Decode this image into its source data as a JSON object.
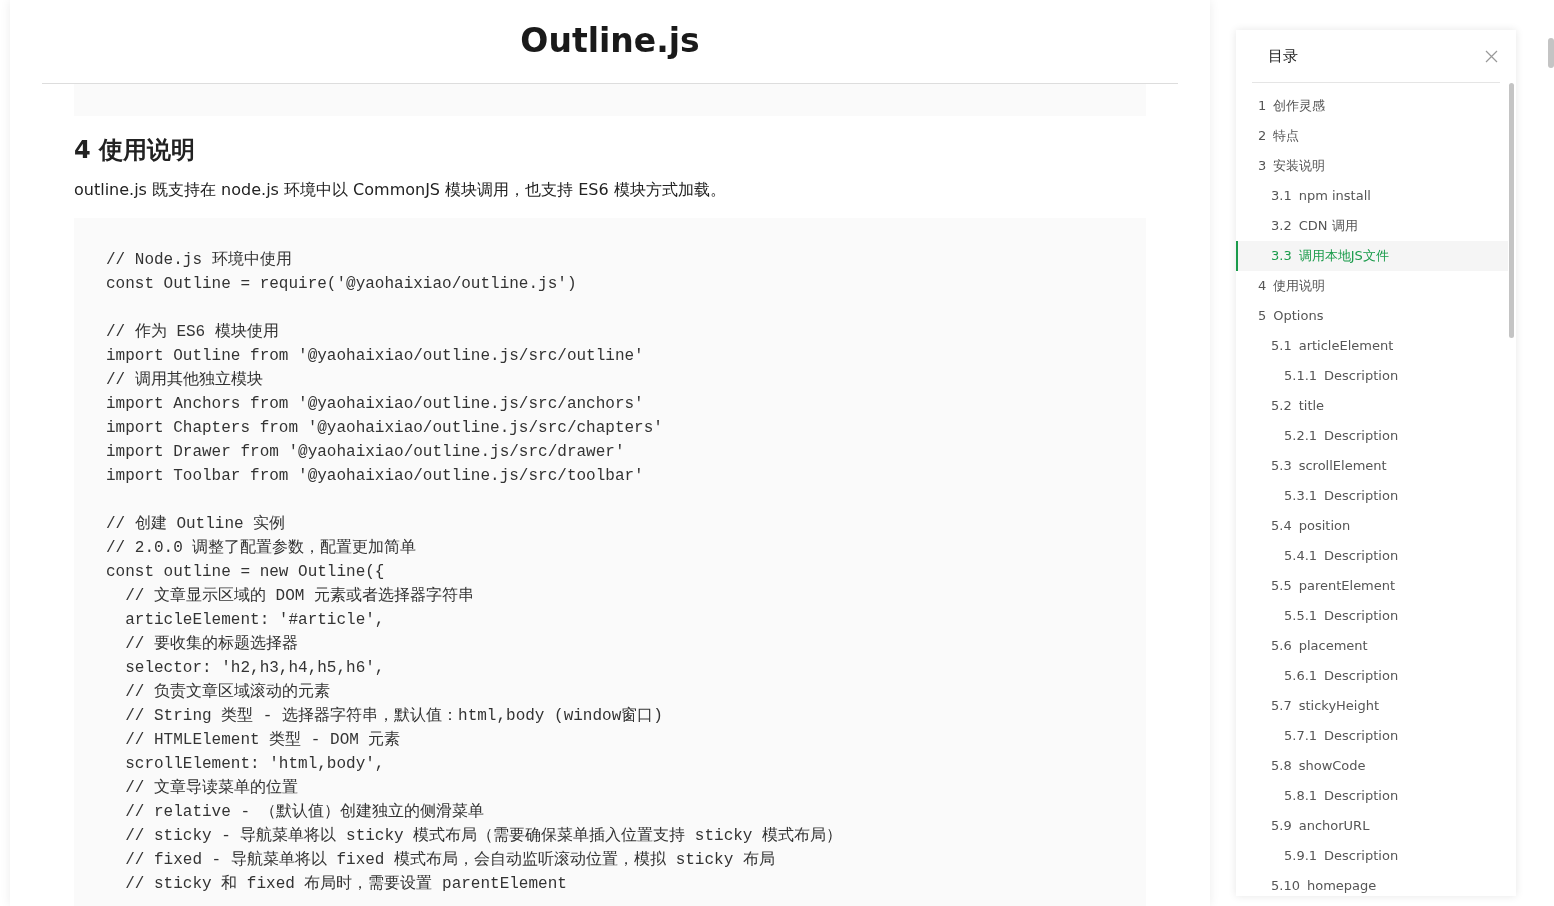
{
  "article": {
    "title": "Outline.js",
    "heading": "4 使用说明",
    "intro": "outline.js 既支持在 node.js 环境中以 CommonJS 模块调用，也支持 ES6 模块方式加载。",
    "code_groups": [
      [
        "// Node.js 环境中使用",
        "const Outline = require('@yaohaixiao/outline.js')"
      ],
      [
        "// 作为 ES6 模块使用",
        "import Outline from '@yaohaixiao/outline.js/src/outline'",
        "// 调用其他独立模块",
        "import Anchors from '@yaohaixiao/outline.js/src/anchors'",
        "import Chapters from '@yaohaixiao/outline.js/src/chapters'",
        "import Drawer from '@yaohaixiao/outline.js/src/drawer'",
        "import Toolbar from '@yaohaixiao/outline.js/src/toolbar'"
      ],
      [
        "// 创建 Outline 实例",
        "// 2.0.0 调整了配置参数，配置更加简单",
        "const outline = new Outline({",
        "  // 文章显示区域的 DOM 元素或者选择器字符串",
        "  articleElement: '#article',",
        "  // 要收集的标题选择器",
        "  selector: 'h2,h3,h4,h5,h6',",
        "  // 负责文章区域滚动的元素",
        "  // String 类型 - 选择器字符串，默认值：html,body (window窗口)",
        "  // HTMLElement 类型 - DOM 元素",
        "  scrollElement: 'html,body',",
        "  // 文章导读菜单的位置",
        "  // relative - （默认值）创建独立的侧滑菜单",
        "  // sticky - 导航菜单将以 sticky 模式布局（需要确保菜单插入位置支持 sticky 模式布局）",
        "  // fixed - 导航菜单将以 fixed 模式布局，会自动监听滚动位置，模拟 sticky 布局",
        "  // sticky 和 fixed 布局时，需要设置 parentElement"
      ]
    ]
  },
  "toc": {
    "title": "目录",
    "items": [
      {
        "number": "1",
        "label": "创作灵感",
        "selected": false
      },
      {
        "number": "2",
        "label": "特点",
        "selected": false
      },
      {
        "number": "3",
        "label": "安装说明",
        "selected": false,
        "children": [
          {
            "number": "3.1",
            "label": "npm install",
            "selected": false
          },
          {
            "number": "3.2",
            "label": "CDN 调用",
            "selected": false
          },
          {
            "number": "3.3",
            "label": "调用本地JS文件",
            "selected": true
          }
        ]
      },
      {
        "number": "4",
        "label": "使用说明",
        "selected": false
      },
      {
        "number": "5",
        "label": "Options",
        "selected": false,
        "children": [
          {
            "number": "5.1",
            "label": "articleElement",
            "selected": false,
            "children": [
              {
                "number": "5.1.1",
                "label": "Description",
                "selected": false
              }
            ]
          },
          {
            "number": "5.2",
            "label": "title",
            "selected": false,
            "children": [
              {
                "number": "5.2.1",
                "label": "Description",
                "selected": false
              }
            ]
          },
          {
            "number": "5.3",
            "label": "scrollElement",
            "selected": false,
            "children": [
              {
                "number": "5.3.1",
                "label": "Description",
                "selected": false
              }
            ]
          },
          {
            "number": "5.4",
            "label": "position",
            "selected": false,
            "children": [
              {
                "number": "5.4.1",
                "label": "Description",
                "selected": false
              }
            ]
          },
          {
            "number": "5.5",
            "label": "parentElement",
            "selected": false,
            "children": [
              {
                "number": "5.5.1",
                "label": "Description",
                "selected": false
              }
            ]
          },
          {
            "number": "5.6",
            "label": "placement",
            "selected": false,
            "children": [
              {
                "number": "5.6.1",
                "label": "Description",
                "selected": false
              }
            ]
          },
          {
            "number": "5.7",
            "label": "stickyHeight",
            "selected": false,
            "children": [
              {
                "number": "5.7.1",
                "label": "Description",
                "selected": false
              }
            ]
          },
          {
            "number": "5.8",
            "label": "showCode",
            "selected": false,
            "children": [
              {
                "number": "5.8.1",
                "label": "Description",
                "selected": false
              }
            ]
          },
          {
            "number": "5.9",
            "label": "anchorURL",
            "selected": false,
            "children": [
              {
                "number": "5.9.1",
                "label": "Description",
                "selected": false
              }
            ]
          },
          {
            "number": "5.10",
            "label": "homepage",
            "selected": false
          }
        ]
      }
    ]
  }
}
